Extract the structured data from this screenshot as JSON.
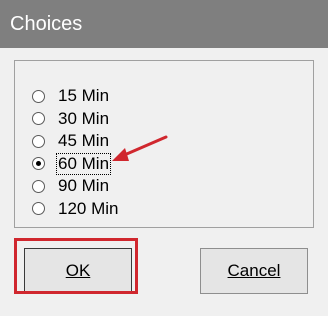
{
  "window": {
    "title": "Choices"
  },
  "options": [
    {
      "label": "15 Min",
      "checked": false
    },
    {
      "label": "30 Min",
      "checked": false
    },
    {
      "label": "45 Min",
      "checked": false
    },
    {
      "label": "60 Min",
      "checked": true
    },
    {
      "label": "90 Min",
      "checked": false
    },
    {
      "label": "120 Min",
      "checked": false
    }
  ],
  "buttons": {
    "ok_label": "OK",
    "cancel_label": "Cancel"
  },
  "colors": {
    "annotation": "#d0272e",
    "titlebar": "#7f7f7f"
  }
}
